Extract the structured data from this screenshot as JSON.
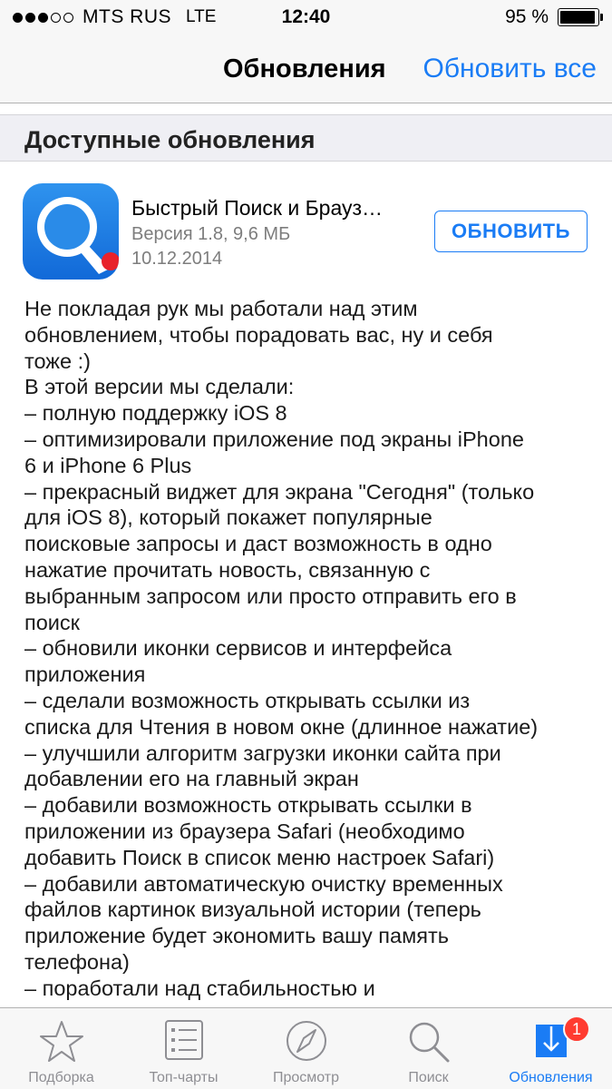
{
  "status_bar": {
    "carrier": "MTS RUS",
    "network": "LTE",
    "time": "12:40",
    "battery": "95 %",
    "battery_level": 0.95,
    "signal_bars": 3,
    "signal_max": 5
  },
  "nav": {
    "title": "Обновления",
    "action_label": "Обновить все"
  },
  "section": {
    "title": "Доступные обновления"
  },
  "app": {
    "name": "Быстрый Поиск и Брауз…",
    "version": "Версия 1.8, 9,6 МБ",
    "date": "10.12.2014",
    "update_label": "ОБНОВИТЬ",
    "icon": "search-magnifier-icon"
  },
  "release_notes": [
    "Не покладая рук мы работали над этим",
    "обновлением, чтобы порадовать вас, ну и себя",
    "тоже :)",
    "В этой версии мы сделали:",
    "– полную поддержку iOS 8",
    "– оптимизировали приложение под экраны iPhone",
    "6 и iPhone 6 Plus",
    "– прекрасный виджет для экрана \"Сегодня\" (только",
    "для iOS 8), который покажет популярные",
    "поисковые запросы и даст возможность в одно",
    "нажатие прочитать новость, связанную с",
    "выбранным запросом или просто отправить его в",
    "поиск",
    "– обновили иконки сервисов и интерфейса",
    "приложения",
    "– сделали возможность открывать ссылки из",
    "списка для Чтения в новом окне (длинное нажатие)",
    "– улучшили алгоритм загрузки иконки сайта при",
    "добавлении его на главный экран",
    "– добавили возможность открывать ссылки в",
    "приложении из браузера Safari (необходимо",
    "добавить Поиск в список меню настроек Safari)",
    "– добавили автоматическую очистку временных",
    "файлов картинок визуальной истории (теперь",
    "приложение будет экономить вашу память",
    "телефона)",
    "– поработали над стабильностью и"
  ],
  "tabs": [
    {
      "label": "Подборка",
      "icon": "star-icon"
    },
    {
      "label": "Топ-чарты",
      "icon": "list-icon"
    },
    {
      "label": "Просмотр",
      "icon": "compass-icon"
    },
    {
      "label": "Поиск",
      "icon": "search-icon"
    },
    {
      "label": "Обновления",
      "icon": "updates-icon",
      "badge": "1",
      "active": true
    }
  ],
  "colors": {
    "accent": "#1a7cf5",
    "badge": "#ff3b30",
    "inactive": "#8e8e93"
  }
}
